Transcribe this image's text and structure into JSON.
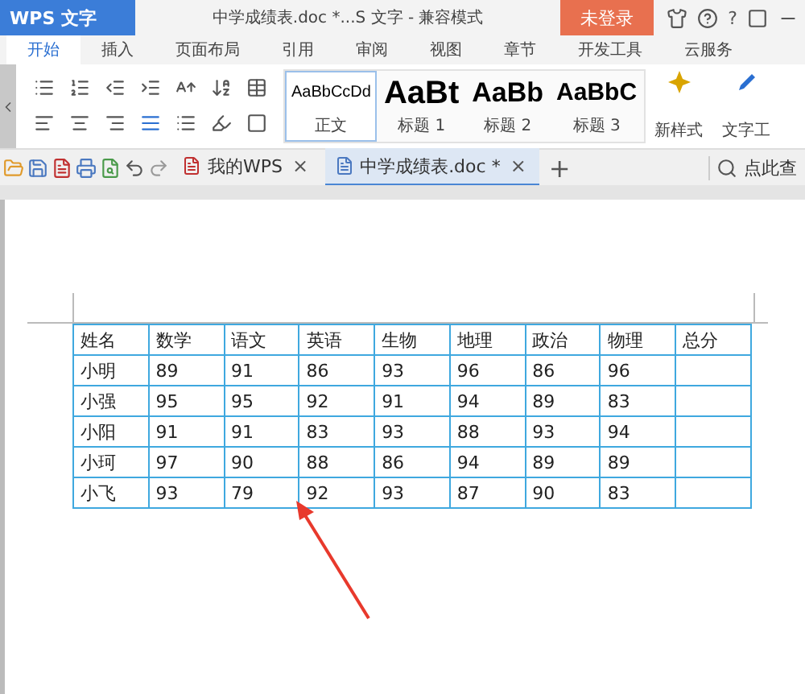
{
  "app_button": {
    "label": "WPS 文字"
  },
  "window": {
    "title": "中学成绩表.doc *...S 文字 - 兼容模式",
    "login": "未登录",
    "help": "?"
  },
  "ribbon_tabs": [
    {
      "label": "开始",
      "selected": true
    },
    {
      "label": "插入",
      "selected": false
    },
    {
      "label": "页面布局",
      "selected": false
    },
    {
      "label": "引用",
      "selected": false
    },
    {
      "label": "审阅",
      "selected": false
    },
    {
      "label": "视图",
      "selected": false
    },
    {
      "label": "章节",
      "selected": false
    },
    {
      "label": "开发工具",
      "selected": false
    },
    {
      "label": "云服务",
      "selected": false
    }
  ],
  "styles": [
    {
      "preview": "AaBbCcDd",
      "name": "正文",
      "selected": true,
      "kind": "body"
    },
    {
      "preview": "AaBt",
      "name": "标题 1",
      "selected": false,
      "kind": "h1"
    },
    {
      "preview": "AaBb",
      "name": "标题 2",
      "selected": false,
      "kind": "h2"
    },
    {
      "preview": "AaBbC",
      "name": "标题 3",
      "selected": false,
      "kind": "h3"
    }
  ],
  "new_style": "新样式",
  "text_tools": "文字工",
  "doc_tabs": [
    {
      "label": "我的WPS",
      "selected": false,
      "close": "×"
    },
    {
      "label": "中学成绩表.doc *",
      "selected": true,
      "close": "×"
    }
  ],
  "new_tab": "+",
  "search": {
    "placeholder": "点此查"
  },
  "table": {
    "columns": [
      "姓名",
      "数学",
      "语文",
      "英语",
      "生物",
      "地理",
      "政治",
      "物理",
      "总分"
    ],
    "rows": [
      [
        "小明",
        "89",
        "91",
        "86",
        "93",
        "96",
        "86",
        "96",
        ""
      ],
      [
        "小强",
        "95",
        "95",
        "92",
        "91",
        "94",
        "89",
        "83",
        ""
      ],
      [
        "小阳",
        "91",
        "91",
        "83",
        "93",
        "88",
        "93",
        "94",
        ""
      ],
      [
        "小珂",
        "97",
        "90",
        "88",
        "86",
        "94",
        "89",
        "89",
        ""
      ],
      [
        "小飞",
        "93",
        "79",
        "92",
        "93",
        "87",
        "90",
        "83",
        ""
      ]
    ]
  }
}
